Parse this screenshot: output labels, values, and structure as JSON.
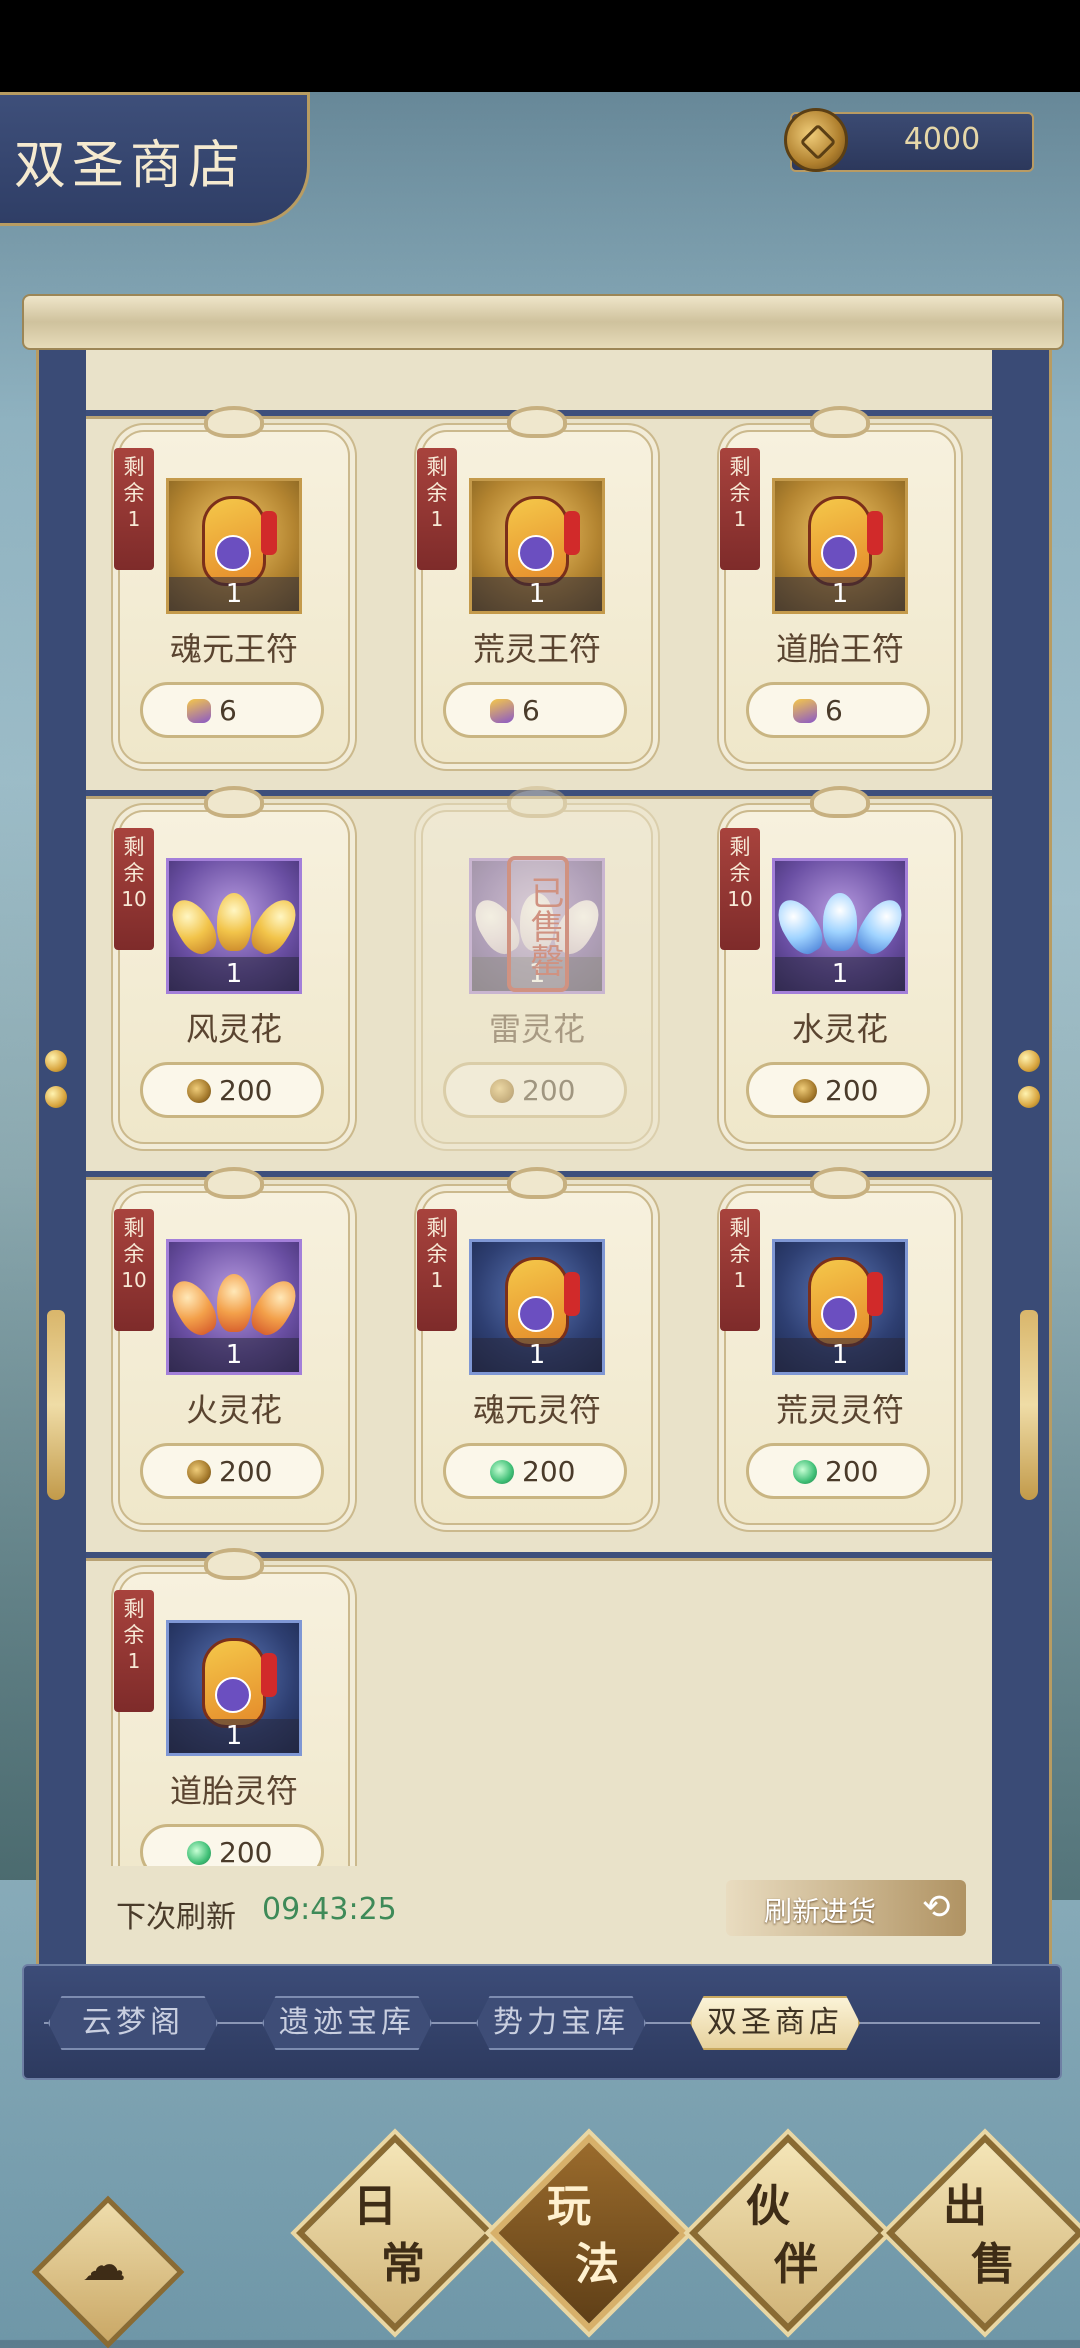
{
  "header": {
    "title": "双圣商店",
    "currency_value": "4000"
  },
  "shop_items": [
    {
      "remain_label": "剩余",
      "remain_count": "1",
      "qty": "1",
      "name": "魂元王符",
      "price": "6",
      "currency": "talisman",
      "art": "talisman",
      "tone": "gold"
    },
    {
      "remain_label": "剩余",
      "remain_count": "1",
      "qty": "1",
      "name": "荒灵王符",
      "price": "6",
      "currency": "talisman",
      "art": "talisman",
      "tone": "gold"
    },
    {
      "remain_label": "剩余",
      "remain_count": "1",
      "qty": "1",
      "name": "道胎王符",
      "price": "6",
      "currency": "talisman",
      "art": "talisman",
      "tone": "gold"
    },
    {
      "remain_label": "剩余",
      "remain_count": "10",
      "qty": "1",
      "name": "风灵花",
      "price": "200",
      "currency": "coin",
      "art": "lotus-yellow",
      "tone": "purple"
    },
    {
      "remain_label": "",
      "remain_count": "",
      "qty": "1",
      "name": "雷灵花",
      "price": "200",
      "currency": "coin",
      "art": "lotus-pale",
      "tone": "purple",
      "sold_out_stamp": "已售罄"
    },
    {
      "remain_label": "剩余",
      "remain_count": "10",
      "qty": "1",
      "name": "水灵花",
      "price": "200",
      "currency": "coin",
      "art": "lotus-ice",
      "tone": "purple"
    },
    {
      "remain_label": "剩余",
      "remain_count": "10",
      "qty": "1",
      "name": "火灵花",
      "price": "200",
      "currency": "coin",
      "art": "lotus-fire",
      "tone": "purple"
    },
    {
      "remain_label": "剩余",
      "remain_count": "1",
      "qty": "1",
      "name": "魂元灵符",
      "price": "200",
      "currency": "jade",
      "art": "talisman",
      "tone": "blue"
    },
    {
      "remain_label": "剩余",
      "remain_count": "1",
      "qty": "1",
      "name": "荒灵灵符",
      "price": "200",
      "currency": "jade",
      "art": "talisman",
      "tone": "blue"
    },
    {
      "remain_label": "剩余",
      "remain_count": "1",
      "qty": "1",
      "name": "道胎灵符",
      "price": "200",
      "currency": "jade",
      "art": "talisman",
      "tone": "blue"
    }
  ],
  "refresh": {
    "label": "下次刷新",
    "time": "09:43:25",
    "button_label": "刷新进货",
    "icon": "refresh-icon"
  },
  "tabs": [
    {
      "label": "云梦阁",
      "active": false
    },
    {
      "label": "遗迹宝库",
      "active": false
    },
    {
      "label": "势力宝库",
      "active": false
    },
    {
      "label": "双圣商店",
      "active": true
    }
  ],
  "bottom_nav": [
    {
      "top": "日",
      "bottom": "常",
      "active": false
    },
    {
      "top": "玩",
      "bottom": "法",
      "active": true
    },
    {
      "top": "伙",
      "bottom": "伴",
      "active": false
    },
    {
      "top": "出",
      "bottom": "售",
      "active": false
    }
  ],
  "colors": {
    "frame_blue": "#3a4b76",
    "paper": "#e9e2c9",
    "accent_gold": "#b89c62",
    "remain_red": "#a8433d",
    "time_green": "#3e8a58"
  }
}
